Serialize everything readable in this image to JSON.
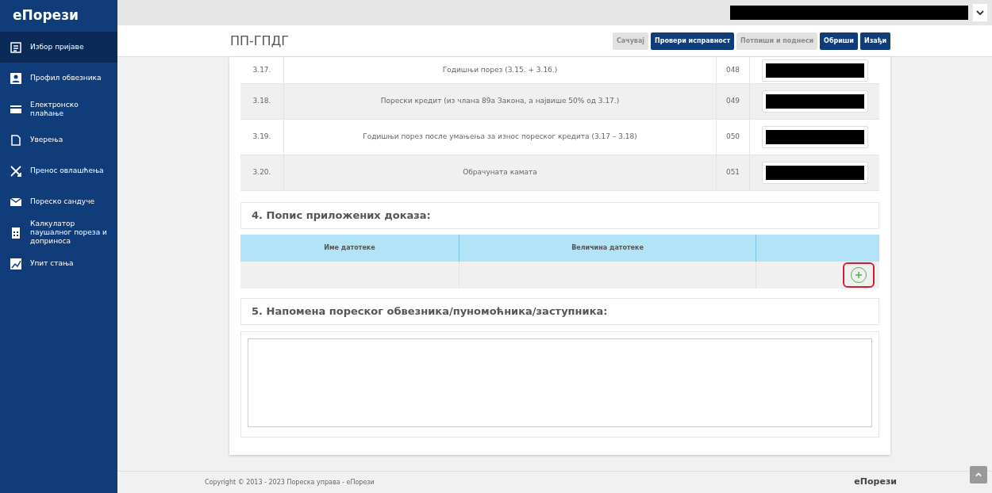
{
  "sidebar": {
    "logo": "еПорези",
    "items": [
      {
        "label": "Избор пријаве",
        "selected": true
      },
      {
        "label": "Профил обвезника",
        "selected": false
      },
      {
        "label": "Електронско плаћање",
        "selected": false
      },
      {
        "label": "Уверења",
        "selected": false
      },
      {
        "label": "Пренос овлашћења",
        "selected": false
      },
      {
        "label": "Пореско сандуче",
        "selected": false
      },
      {
        "label": "Калкулатор паушалног пореза и доприноса",
        "selected": false
      },
      {
        "label": "Упит стања",
        "selected": false
      }
    ]
  },
  "header": {
    "title": "ПП-ГПДГ",
    "buttons": [
      {
        "label": "Сачувај",
        "disabled": true
      },
      {
        "label": "Провери исправност",
        "disabled": false
      },
      {
        "label": "Потпиши и поднеси",
        "disabled": true
      },
      {
        "label": "Обриши",
        "disabled": false
      },
      {
        "label": "Изађи",
        "disabled": false
      }
    ]
  },
  "rows": [
    {
      "number": "3.17.",
      "description": "Годишњи порез (3.15. + 3.16.)",
      "code": "048"
    },
    {
      "number": "3.18.",
      "description": "Порески кредит (из члана 89а Закона, а највише 50% од 3.17.)",
      "code": "049"
    },
    {
      "number": "3.19.",
      "description": "Годишњи порез после умањења за износ пореског кредита (3.17 – 3.18)",
      "code": "050"
    },
    {
      "number": "3.20.",
      "description": "Обрачуната камата",
      "code": "051"
    }
  ],
  "attachments": {
    "title": "4. Попис приложених доказа:",
    "columns": [
      "Име датотеке",
      "Величина датотеке"
    ]
  },
  "note": {
    "title": "5. Напомена пореског обвезника/пуномоћника/заступника:"
  },
  "footer": {
    "copyright": "Copyright © 2013 - 2023 Пореска управа - еПорези",
    "logo": "еПорези"
  }
}
